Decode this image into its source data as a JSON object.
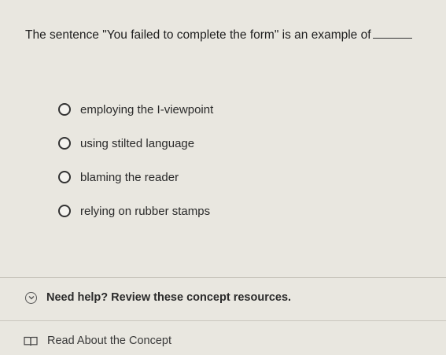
{
  "question": {
    "text": "The sentence \"You failed to complete the form\" is an example of"
  },
  "options": [
    {
      "label": "employing the I-viewpoint"
    },
    {
      "label": "using stilted language"
    },
    {
      "label": "blaming the reader"
    },
    {
      "label": "relying on rubber stamps"
    }
  ],
  "help": {
    "text": "Need help? Review these concept resources.",
    "icon": "chevron-down-circle-icon"
  },
  "resources": {
    "read_label": "Read About the Concept",
    "icon": "book-icon"
  }
}
